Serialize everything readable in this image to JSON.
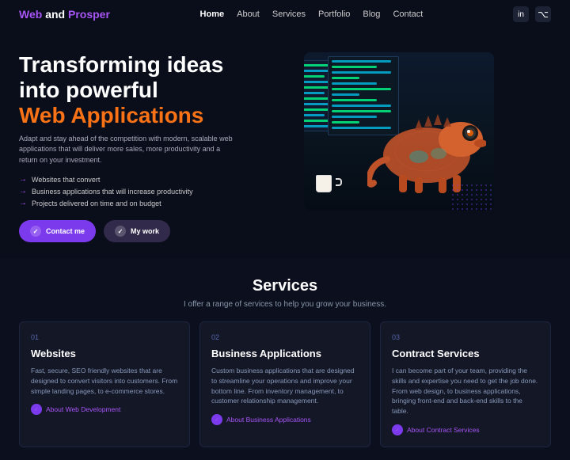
{
  "brand": {
    "web": "Web",
    "and": " and ",
    "prosper": "Prosper"
  },
  "nav": {
    "links": [
      {
        "label": "Home",
        "active": true
      },
      {
        "label": "About",
        "active": false
      },
      {
        "label": "Services",
        "active": false
      },
      {
        "label": "Portfolio",
        "active": false
      },
      {
        "label": "Blog",
        "active": false
      },
      {
        "label": "Contact",
        "active": false
      }
    ],
    "icons": [
      {
        "name": "linkedin-icon",
        "symbol": "in"
      },
      {
        "name": "github-icon",
        "symbol": "⌥"
      }
    ]
  },
  "hero": {
    "title_line1": "Transforming ideas",
    "title_line2": "into powerful",
    "title_highlight": "Web Applications",
    "description": "Adapt and stay ahead of the competition with modern, scalable web applications that will deliver more sales, more productivity and a return on your investment.",
    "bullets": [
      "Websites that convert",
      "Business applications that will increase productivity",
      "Projects delivered on time and on budget"
    ],
    "buttons": {
      "contact": "Contact me",
      "work": "My work"
    }
  },
  "services": {
    "title": "Services",
    "subtitle": "I offer a range of services to help you grow your business.",
    "cards": [
      {
        "num": "01",
        "name": "Websites",
        "description": "Fast, secure, SEO friendly websites that are designed to convert visitors into customers. From simple landing pages, to e-commerce stores.",
        "link": "About Web Development"
      },
      {
        "num": "02",
        "name": "Business Applications",
        "description": "Custom business applications that are designed to streamline your operations and improve your bottom line. From inventory management, to customer relationship management.",
        "link": "About Business Applications"
      },
      {
        "num": "03",
        "name": "Contract Services",
        "description": "I can become part of your team, providing the skills and expertise you need to get the job done. From web design, to business applications, bringing front-end and back-end skills to the table.",
        "link": "About Contract Services"
      }
    ]
  }
}
